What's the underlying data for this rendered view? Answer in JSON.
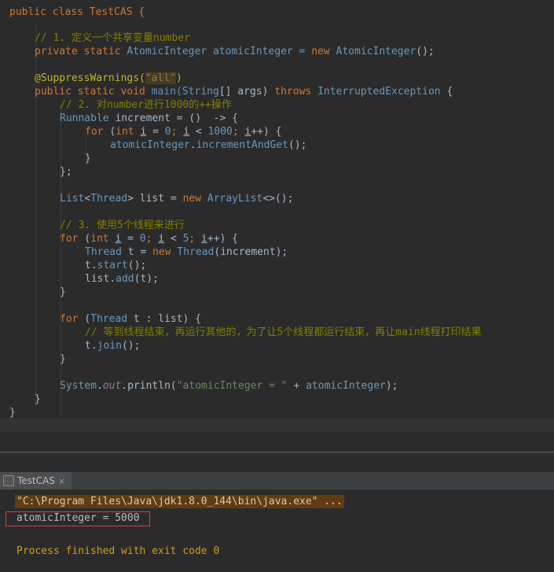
{
  "editor": {
    "lines": {
      "l1": "public class TestCAS {",
      "c1": "// 1. 定义一个共享变量number",
      "l3a": "private static ",
      "l3b": "AtomicInteger",
      "l3c": " atomicInteger = ",
      "l3d": "new ",
      "l3e": "AtomicInteger",
      "l3f": "();",
      "ann": "@SuppressWarnings(",
      "ann_str": "\"all\"",
      "ann_end": ")",
      "m1": "public static void ",
      "m2": "main(",
      "m3": "String",
      "m4": "[] args) ",
      "m5": "throws ",
      "m6": "InterruptedException",
      "m7": " {",
      "c2": "// 2. 对number进行1000的++操作",
      "r1": "Runnable",
      "r2": " increment = ()  -> {",
      "f1": "for ",
      "f2": "(",
      "f3": "int ",
      "f4": "i",
      "f5": " = ",
      "f6": "0",
      "f7": "; ",
      "f8": "i",
      "f9": " < ",
      "f10": "1000",
      "f11": "; ",
      "f12": "i",
      "f13": "++) {",
      "inc1": "atomicInteger",
      "inc2": ".",
      "inc3": "incrementAndGet",
      "inc4": "();",
      "close1": "}",
      "close2": "};",
      "list1": "List",
      "list2": "<",
      "list3": "Thread",
      "list4": "> list = ",
      "list5": "new ",
      "list6": "ArrayList",
      "list7": "<>();",
      "c3": "// 3. 使用5个线程来进行",
      "g1": "for ",
      "g2": "(",
      "g3": "int ",
      "g4": "i",
      "g5": " = ",
      "g6": "0",
      "g7": "; ",
      "g8": "i",
      "g9": " < ",
      "g10": "5",
      "g11": "; ",
      "g12": "i",
      "g13": "++) {",
      "t1": "Thread",
      "t2": " t = ",
      "t3": "new ",
      "t4": "Thread",
      "t5": "(increment);",
      "s1": "t.",
      "s2": "start",
      "s3": "();",
      "a1": "list.",
      "a2": "add",
      "a3": "(t);",
      "close3": "}",
      "h1": "for ",
      "h2": "(",
      "h3": "Thread",
      "h4": " t : list) {",
      "c4": "// 等到线程结束，再运行其他的，为了让5个线程都运行结束，再让main线程打印结果",
      "j1": "t.",
      "j2": "join",
      "j3": "();",
      "close4": "}",
      "p1": "System",
      "p2": ".",
      "p3": "out",
      "p4": ".println(",
      "p5": "\"atomicInteger = \"",
      "p6": " + ",
      "p7": "atomicInteger",
      "p8": ");",
      "close5": "}",
      "close6": "}"
    }
  },
  "console": {
    "tab_label": "TestCAS",
    "tab_close": "×",
    "command": "\"C:\\Program Files\\Java\\jdk1.8.0_144\\bin\\java.exe\" ...",
    "result": "atomicInteger = 5000",
    "exit": "Process finished with exit code 0"
  },
  "colors": {
    "background": "#2b2b2b",
    "keyword": "#cc7832",
    "comment": "#808000",
    "string": "#6a8759",
    "number": "#6897bb",
    "highlight_box": "#e03c3c"
  },
  "icons": [
    "run-config-icon",
    "close-icon"
  ]
}
